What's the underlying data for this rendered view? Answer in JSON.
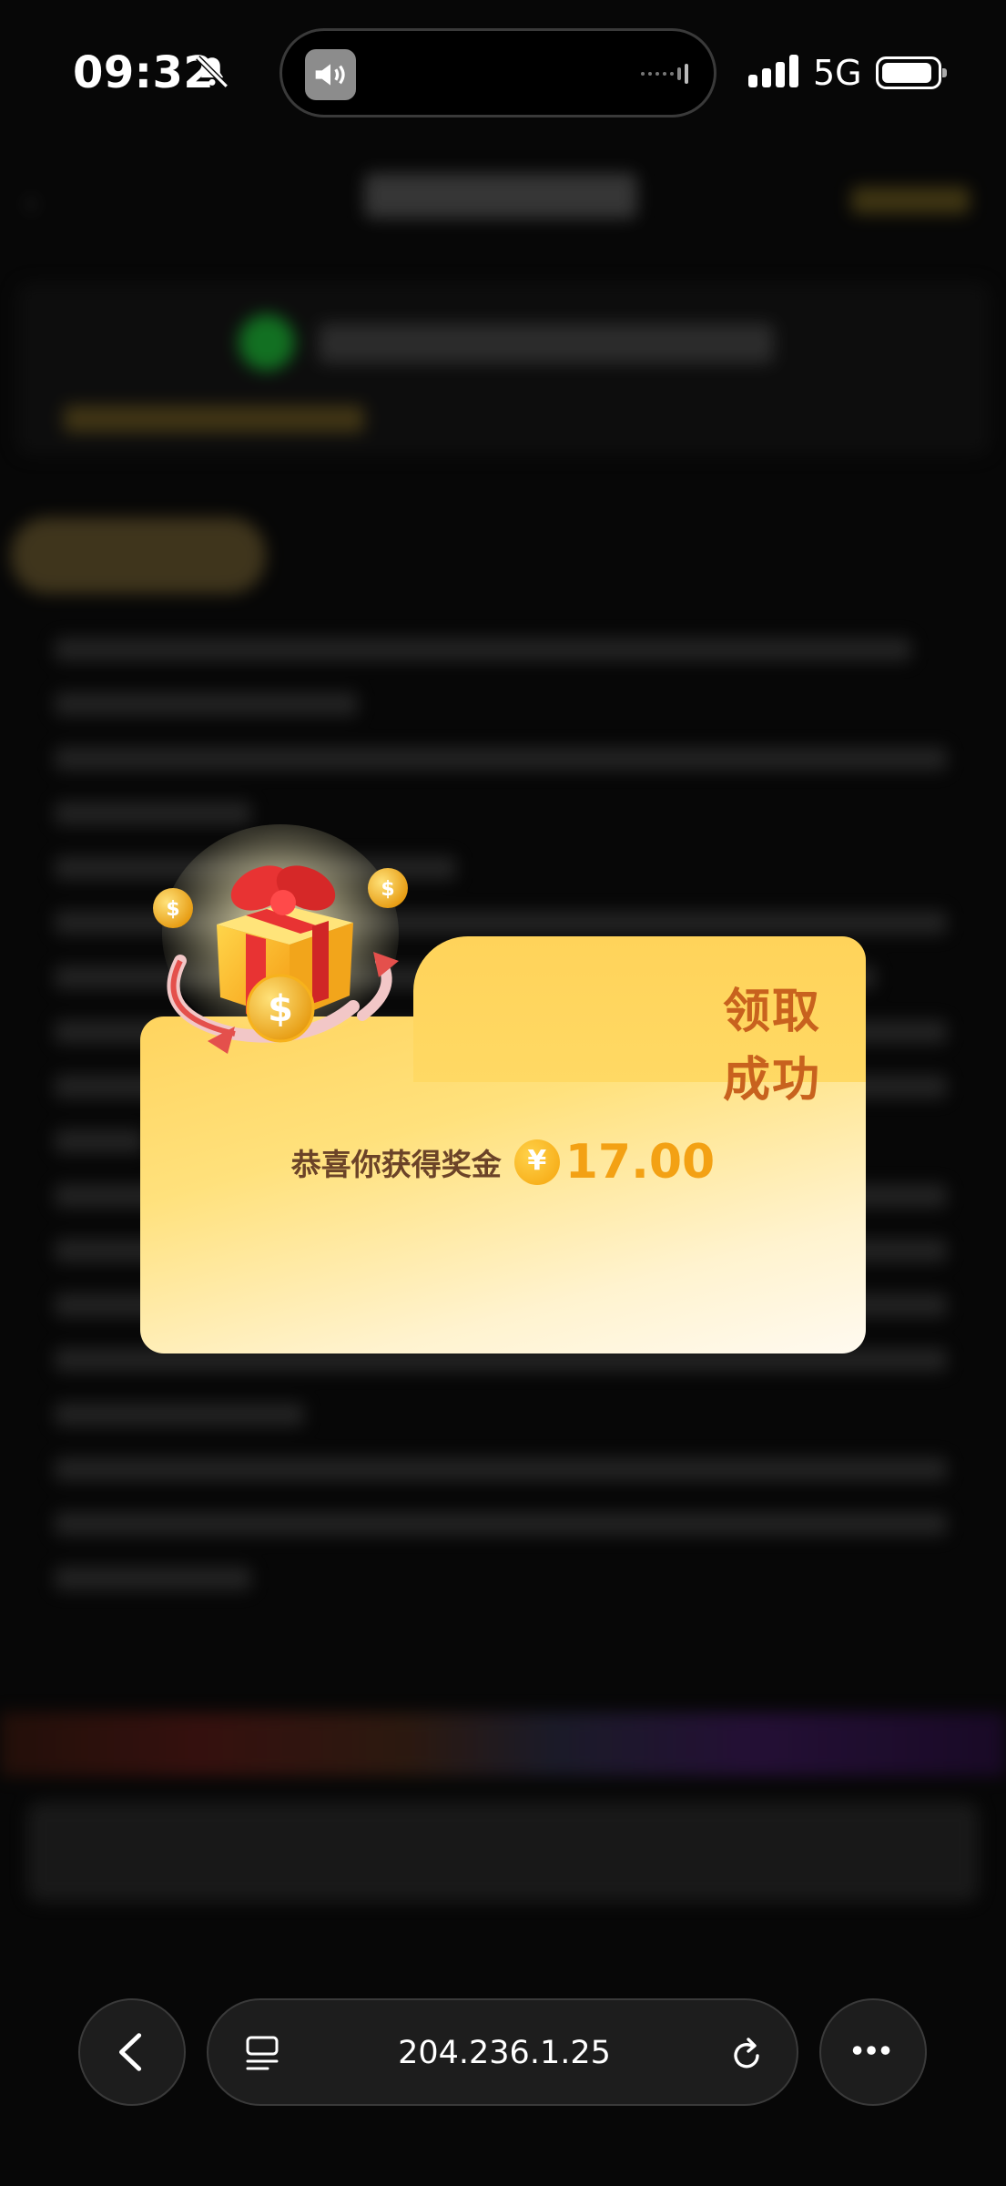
{
  "status_bar": {
    "time": "09:32",
    "network": "5G",
    "icons": [
      "bell-off-icon",
      "speaker-icon",
      "signal-icon",
      "battery-icon"
    ]
  },
  "popup": {
    "title": "领取成功",
    "reward_text": "恭喜你获得奖金",
    "currency_symbol": "¥",
    "amount": "17.00",
    "icons": [
      "gift-icon",
      "coin-icon",
      "close-icon"
    ]
  },
  "browser": {
    "url": "204.236.1.25",
    "icons": [
      "back-icon",
      "tabs-icon",
      "reload-icon",
      "more-icon"
    ]
  },
  "colors": {
    "popup_title": "#c8621e",
    "amount": "#f3a114",
    "popup_top": "#ffd45e",
    "popup_bottom": "#fffaf0"
  }
}
